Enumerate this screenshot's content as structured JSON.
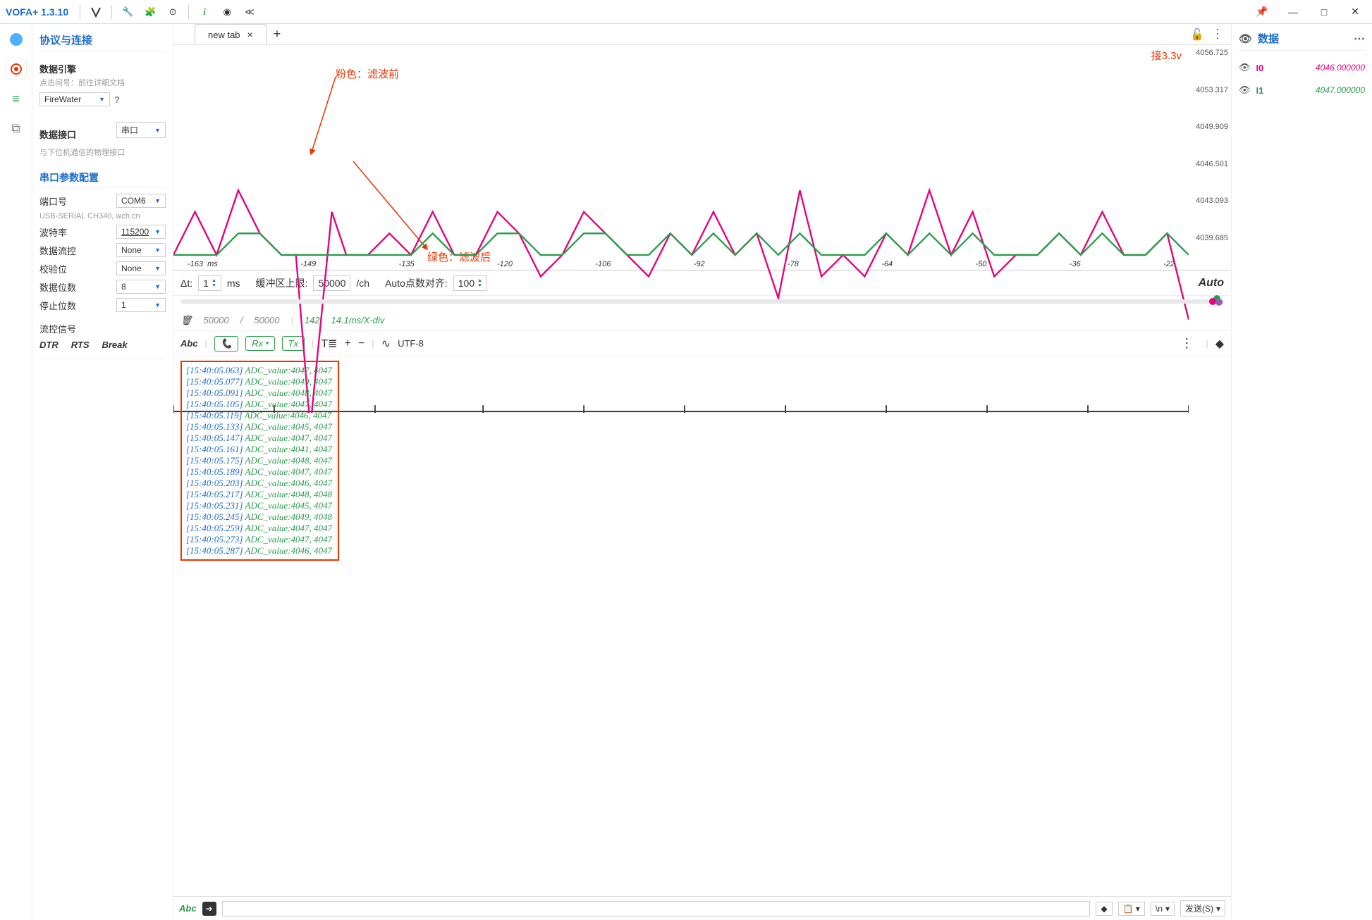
{
  "app": {
    "title": "VOFA+ 1.3.10"
  },
  "sidebar": {
    "title": "协议与连接",
    "engine_title": "数据引擎",
    "engine_hint": "点击问号：前往详细文档",
    "engine_value": "FireWater",
    "interface_title": "数据接口",
    "interface_hint": "与下位机通信的物理接口",
    "interface_value": "串口",
    "serial_title": "串口参数配置",
    "port_label": "端口号",
    "port_value": "COM6",
    "port_hint": "USB-SERIAL CH340, wch.cn",
    "baud_label": "波特率",
    "baud_value": "115200",
    "flow_label": "数据流控",
    "flow_value": "None",
    "parity_label": "校验位",
    "parity_value": "None",
    "databits_label": "数据位数",
    "databits_value": "8",
    "stopbits_label": "停止位数",
    "stopbits_value": "1",
    "signal_title": "流控信号",
    "sig_dtr": "DTR",
    "sig_rts": "RTS",
    "sig_break": "Break"
  },
  "tabs": {
    "tab0": "new tab"
  },
  "chart": {
    "anno_v33": "接3.3v",
    "anno_pink": "粉色：滤波前",
    "anno_green": "绿色：滤波后",
    "yticks": [
      "4056.725",
      "4053.317",
      "4049.909",
      "4046.501",
      "4043.093",
      "4039.685"
    ],
    "xticks": [
      "-163",
      "-149",
      "-135",
      "-120",
      "-106",
      "-92",
      "-78",
      "-64",
      "-50",
      "-36",
      "-22"
    ],
    "xunit": "ms"
  },
  "chart_data": {
    "type": "line",
    "title": "",
    "xlabel": "ms",
    "ylabel": "",
    "ylim": [
      4039.685,
      4056.725
    ],
    "xlim": [
      -163,
      -22
    ],
    "series": [
      {
        "name": "I0 (滤波前)",
        "color": "#e6007e",
        "x": [
          -163,
          -160,
          -157,
          -154,
          -151,
          -148,
          -146,
          -144,
          -141,
          -139,
          -136,
          -133,
          -130,
          -127,
          -124,
          -121,
          -118,
          -115,
          -112,
          -109,
          -106,
          -103,
          -100,
          -97,
          -94,
          -91,
          -88,
          -85,
          -82,
          -79,
          -76,
          -73,
          -70,
          -67,
          -64,
          -61,
          -58,
          -55,
          -52,
          -49,
          -46,
          -43,
          -40,
          -37,
          -34,
          -31,
          -28,
          -25,
          -22
        ],
        "values": [
          4047,
          4049,
          4047,
          4050,
          4048,
          4047,
          4047,
          4039,
          4049,
          4047,
          4047,
          4048,
          4047,
          4049,
          4047,
          4047,
          4049,
          4048,
          4046,
          4047,
          4049,
          4048,
          4047,
          4046,
          4048,
          4047,
          4049,
          4047,
          4048,
          4045,
          4050,
          4046,
          4047,
          4046,
          4048,
          4047,
          4050,
          4047,
          4049,
          4046,
          4047,
          4047,
          4048,
          4047,
          4049,
          4047,
          4047,
          4048,
          4044
        ]
      },
      {
        "name": "I1 (滤波后)",
        "color": "#2a9d4a",
        "x": [
          -163,
          -160,
          -157,
          -154,
          -151,
          -148,
          -146,
          -144,
          -141,
          -139,
          -136,
          -133,
          -130,
          -127,
          -124,
          -121,
          -118,
          -115,
          -112,
          -109,
          -106,
          -103,
          -100,
          -97,
          -94,
          -91,
          -88,
          -85,
          -82,
          -79,
          -76,
          -73,
          -70,
          -67,
          -64,
          -61,
          -58,
          -55,
          -52,
          -49,
          -46,
          -43,
          -40,
          -37,
          -34,
          -31,
          -28,
          -25,
          -22
        ],
        "values": [
          4047,
          4047,
          4047,
          4048,
          4048,
          4047,
          4047,
          4047,
          4047,
          4047,
          4047,
          4047,
          4047,
          4048,
          4047,
          4047,
          4048,
          4048,
          4047,
          4047,
          4048,
          4048,
          4047,
          4047,
          4048,
          4047,
          4048,
          4047,
          4048,
          4047,
          4048,
          4047,
          4047,
          4047,
          4048,
          4047,
          4048,
          4047,
          4048,
          4047,
          4047,
          4047,
          4048,
          4047,
          4048,
          4047,
          4047,
          4048,
          4047
        ]
      }
    ]
  },
  "controls": {
    "dt_label": "Δt:",
    "dt_value": "1",
    "dt_unit": "ms",
    "buf_label": "缓冲区上限:",
    "buf_value": "50000",
    "buf_unit": "/ch",
    "align_label": "Auto点数对齐:",
    "align_value": "100",
    "auto": "Auto"
  },
  "info": {
    "count1": "50000",
    "slash": "/",
    "count2": "50000",
    "n": "142",
    "rate": "14.1ms/X-div"
  },
  "term_toolbar": {
    "abc": "Abc",
    "rx": "Rx",
    "tx": "Tx",
    "encoding": "UTF-8"
  },
  "terminal_lines": [
    {
      "ts": "[15:40:05.063]",
      "msg": "ADC_value:4047, 4047"
    },
    {
      "ts": "[15:40:05.077]",
      "msg": "ADC_value:4049, 4047"
    },
    {
      "ts": "[15:40:05.091]",
      "msg": "ADC_value:4048, 4047"
    },
    {
      "ts": "[15:40:05.105]",
      "msg": "ADC_value:4047, 4047"
    },
    {
      "ts": "[15:40:05.119]",
      "msg": "ADC_value:4046, 4047"
    },
    {
      "ts": "[15:40:05.133]",
      "msg": "ADC_value:4045, 4047"
    },
    {
      "ts": "[15:40:05.147]",
      "msg": "ADC_value:4047, 4047"
    },
    {
      "ts": "[15:40:05.161]",
      "msg": "ADC_value:4041, 4047"
    },
    {
      "ts": "[15:40:05.175]",
      "msg": "ADC_value:4048, 4047"
    },
    {
      "ts": "[15:40:05.189]",
      "msg": "ADC_value:4047, 4047"
    },
    {
      "ts": "[15:40:05.203]",
      "msg": "ADC_value:4046, 4047"
    },
    {
      "ts": "[15:40:05.217]",
      "msg": "ADC_value:4048, 4048"
    },
    {
      "ts": "[15:40:05.231]",
      "msg": "ADC_value:4045, 4047"
    },
    {
      "ts": "[15:40:05.245]",
      "msg": "ADC_value:4049, 4048"
    },
    {
      "ts": "[15:40:05.259]",
      "msg": "ADC_value:4047, 4047"
    },
    {
      "ts": "[15:40:05.273]",
      "msg": "ADC_value:4047, 4047"
    },
    {
      "ts": "[15:40:05.287]",
      "msg": "ADC_value:4046, 4047"
    }
  ],
  "send": {
    "abc": "Abc",
    "newline": "\\n",
    "send_label": "发送(S)"
  },
  "right": {
    "title": "数据",
    "rows": [
      {
        "name": "I0",
        "val": "4046.000000",
        "color": "pink"
      },
      {
        "name": "I1",
        "val": "4047.000000",
        "color": "dgreen"
      }
    ]
  }
}
